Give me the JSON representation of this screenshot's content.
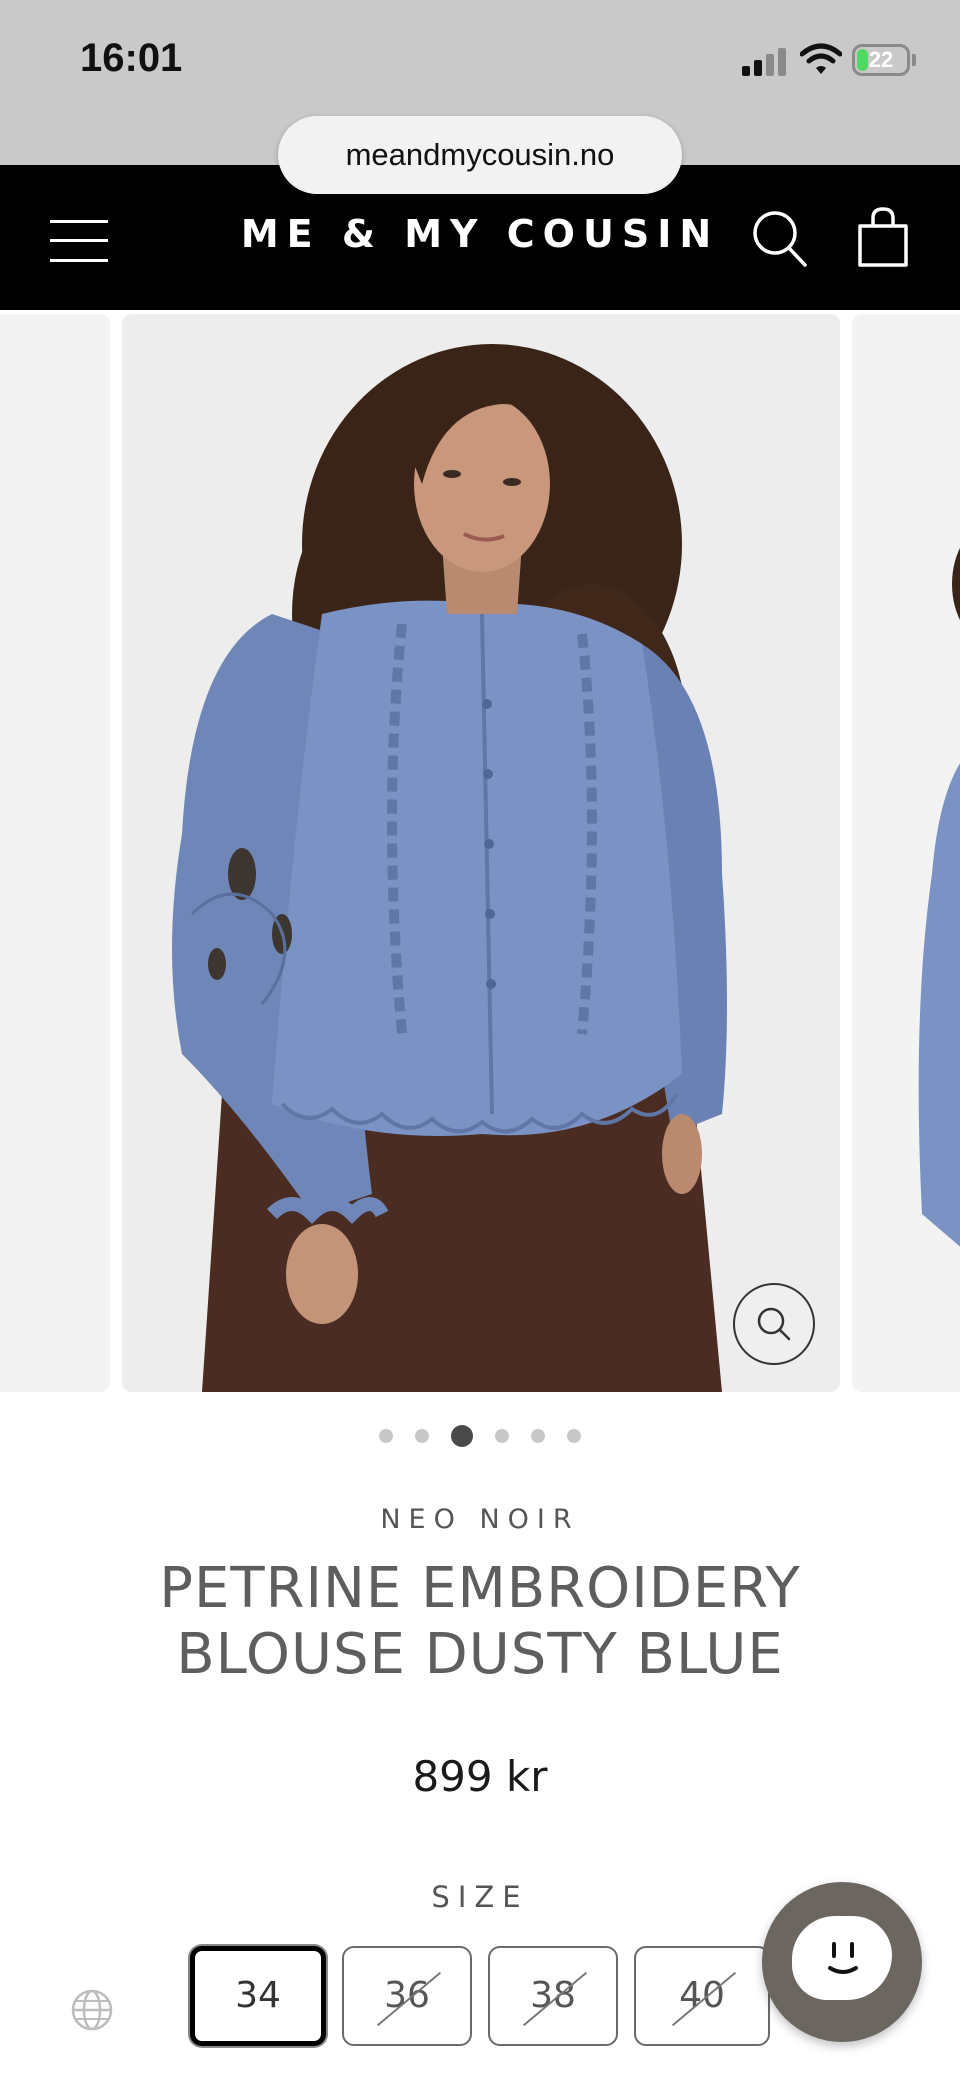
{
  "status_bar": {
    "time": "16:01",
    "battery_level": "22",
    "battery_fill_fraction": 0.22,
    "battery_color": "#4cd964"
  },
  "browser": {
    "url": "meandmycousin.no"
  },
  "header": {
    "brand": "ME & MY COUSIN",
    "background_color": "#000000",
    "icons": [
      "menu-icon",
      "search-icon",
      "shopping-bag-icon"
    ]
  },
  "gallery": {
    "slide_count": 6,
    "active_index": 2,
    "zoom_icon": "magnifier-icon"
  },
  "product": {
    "vendor": "NEO NOIR",
    "title_line1": "PETRINE EMBROIDERY",
    "title_line2": "BLOUSE DUSTY BLUE",
    "price": "899 kr",
    "size_label": "SIZE",
    "sizes": [
      {
        "label": "34",
        "available": true,
        "selected": true
      },
      {
        "label": "36",
        "available": false,
        "selected": false
      },
      {
        "label": "38",
        "available": false,
        "selected": false
      },
      {
        "label": "40",
        "available": false,
        "selected": false
      }
    ]
  },
  "widgets": {
    "language_icon": "globe-icon",
    "chat_icon": "chat-face-icon",
    "chat_color": "#6c6660"
  }
}
